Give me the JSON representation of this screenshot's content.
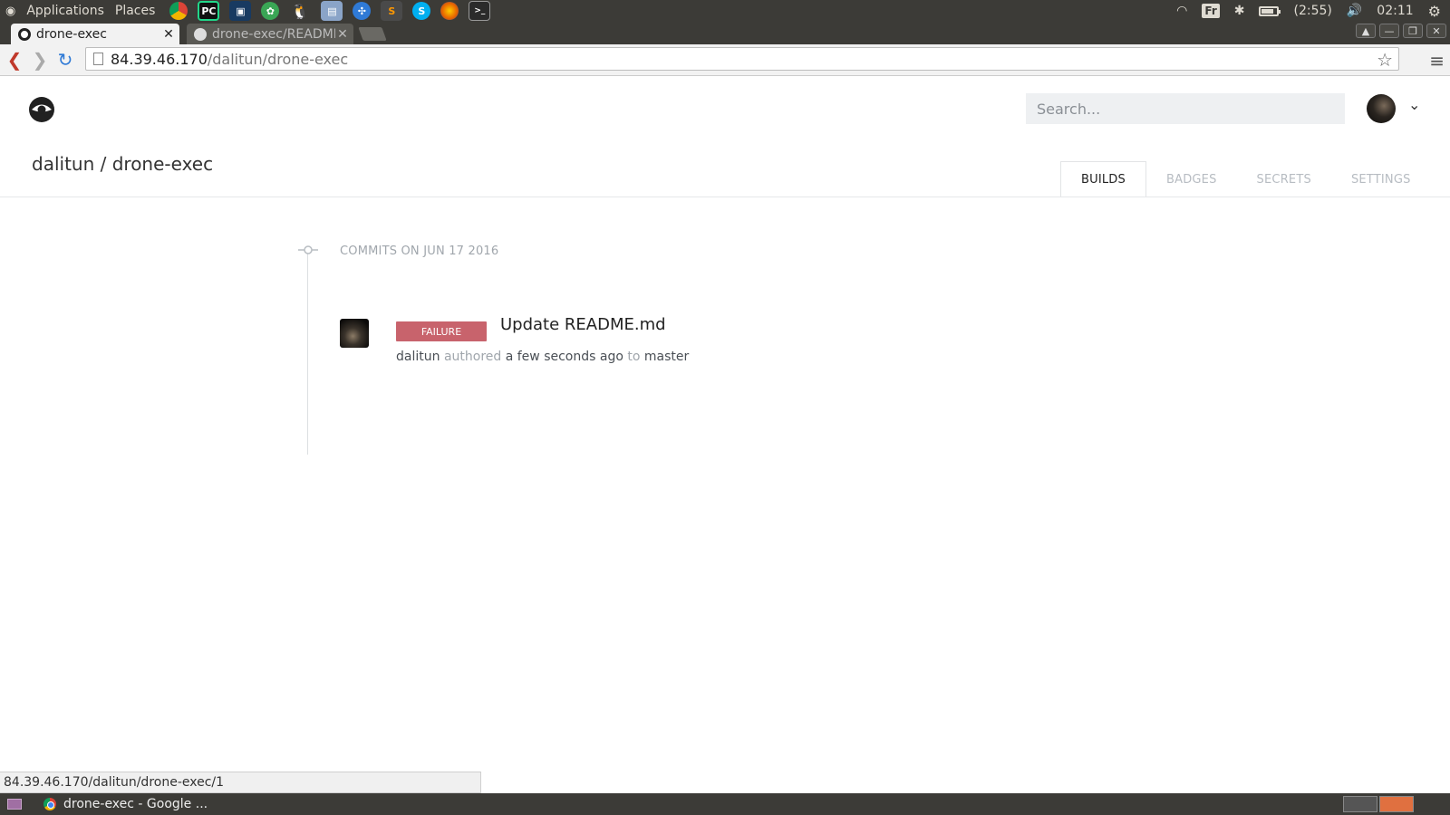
{
  "top_panel": {
    "menu": [
      "Applications",
      "Places"
    ],
    "launcher_apps": [
      {
        "icon": "chrome-icon",
        "glyph": "",
        "color": "#4285f4"
      },
      {
        "icon": "pycharm-icon",
        "glyph": "PC",
        "color": "#21d789"
      },
      {
        "icon": "virtualbox-icon",
        "glyph": "",
        "color": "#183a61"
      },
      {
        "icon": "app-green-icon",
        "glyph": "",
        "color": "#3aa655"
      },
      {
        "icon": "tux-icon",
        "glyph": "",
        "color": "#f0c02a"
      },
      {
        "icon": "remote-desktop-icon",
        "glyph": "",
        "color": "#8aa4c8"
      },
      {
        "icon": "network-icon",
        "glyph": "",
        "color": "#2f7ad6"
      },
      {
        "icon": "sublime-icon",
        "glyph": "S",
        "color": "#ff9800"
      },
      {
        "icon": "skype-icon",
        "glyph": "S",
        "color": "#00aff0"
      },
      {
        "icon": "firefox-icon",
        "glyph": "",
        "color": "#e66000"
      },
      {
        "icon": "terminal-icon",
        "glyph": ">_",
        "color": "#2b2b2b"
      }
    ],
    "tray": {
      "keyboard_layout": "Fr",
      "battery_time": "(2:55)",
      "clock": "02:11"
    }
  },
  "browser": {
    "tabs": [
      {
        "title": "drone-exec",
        "active": true
      },
      {
        "title": "drone-exec/README",
        "active": false
      }
    ],
    "url_host": "84.39.46.170",
    "url_path": "/dalitun/drone-exec",
    "status_url": "84.39.46.170/dalitun/drone-exec/1"
  },
  "header": {
    "search_placeholder": "Search..."
  },
  "repo": {
    "title": "dalitun / drone-exec",
    "tabs": [
      {
        "label": "BUILDS",
        "active": true
      },
      {
        "label": "BADGES",
        "active": false
      },
      {
        "label": "SECRETS",
        "active": false
      },
      {
        "label": "SETTINGS",
        "active": false
      }
    ]
  },
  "builds": {
    "group_header": "COMMITS ON JUN 17 2016",
    "items": [
      {
        "status": "FAILURE",
        "status_color": "#c8636c",
        "message": "Update README.md",
        "author": "dalitun",
        "authored_label": "authored",
        "time": "a few seconds ago",
        "to_label": "to",
        "branch": "master"
      }
    ]
  },
  "taskbar": {
    "window_title": "drone-exec - Google ..."
  }
}
